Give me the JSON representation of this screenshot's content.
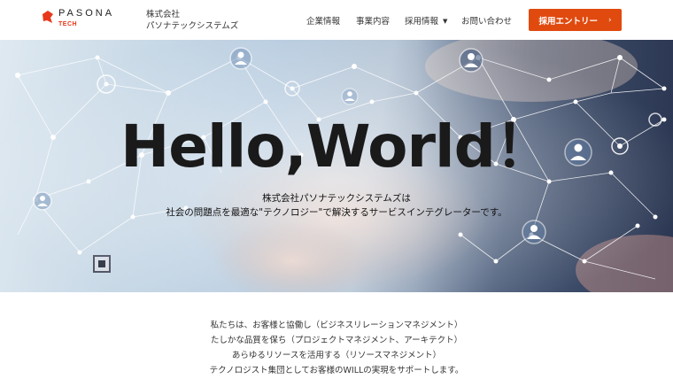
{
  "header": {
    "logo": {
      "word": "PASONA",
      "sub": "TECH",
      "brand_color": "#e8381c"
    },
    "company_lines": [
      "株式会社",
      "パソナテックシステムズ"
    ],
    "nav": [
      {
        "label": "企業情報",
        "has_dropdown": false
      },
      {
        "label": "事業内容",
        "has_dropdown": false
      },
      {
        "label": "採用情報",
        "has_dropdown": true
      },
      {
        "label": "お問い合わせ",
        "has_dropdown": false
      }
    ],
    "entry_button": {
      "label": "採用エントリー",
      "chevron": "›",
      "color": "#e04a0f"
    }
  },
  "hero": {
    "title": "Hello,World！",
    "subtitle_lines": [
      "株式会社パソナテックシステムズは",
      "社会の問題点を最適な\"テクノロジー\"で解決するサービスインテグレーターです。"
    ]
  },
  "intro": {
    "lines": [
      "私たちは、お客様と協働し（ビジネスリレーションマネジメント）",
      "たしかな品質を保ち（プロジェクトマネジメント、アーキテクト）",
      "あらゆるリソースを活用する（リソースマネジメント）",
      "テクノロジスト集団としてお客様のWILLの実現をサポートします。"
    ]
  }
}
